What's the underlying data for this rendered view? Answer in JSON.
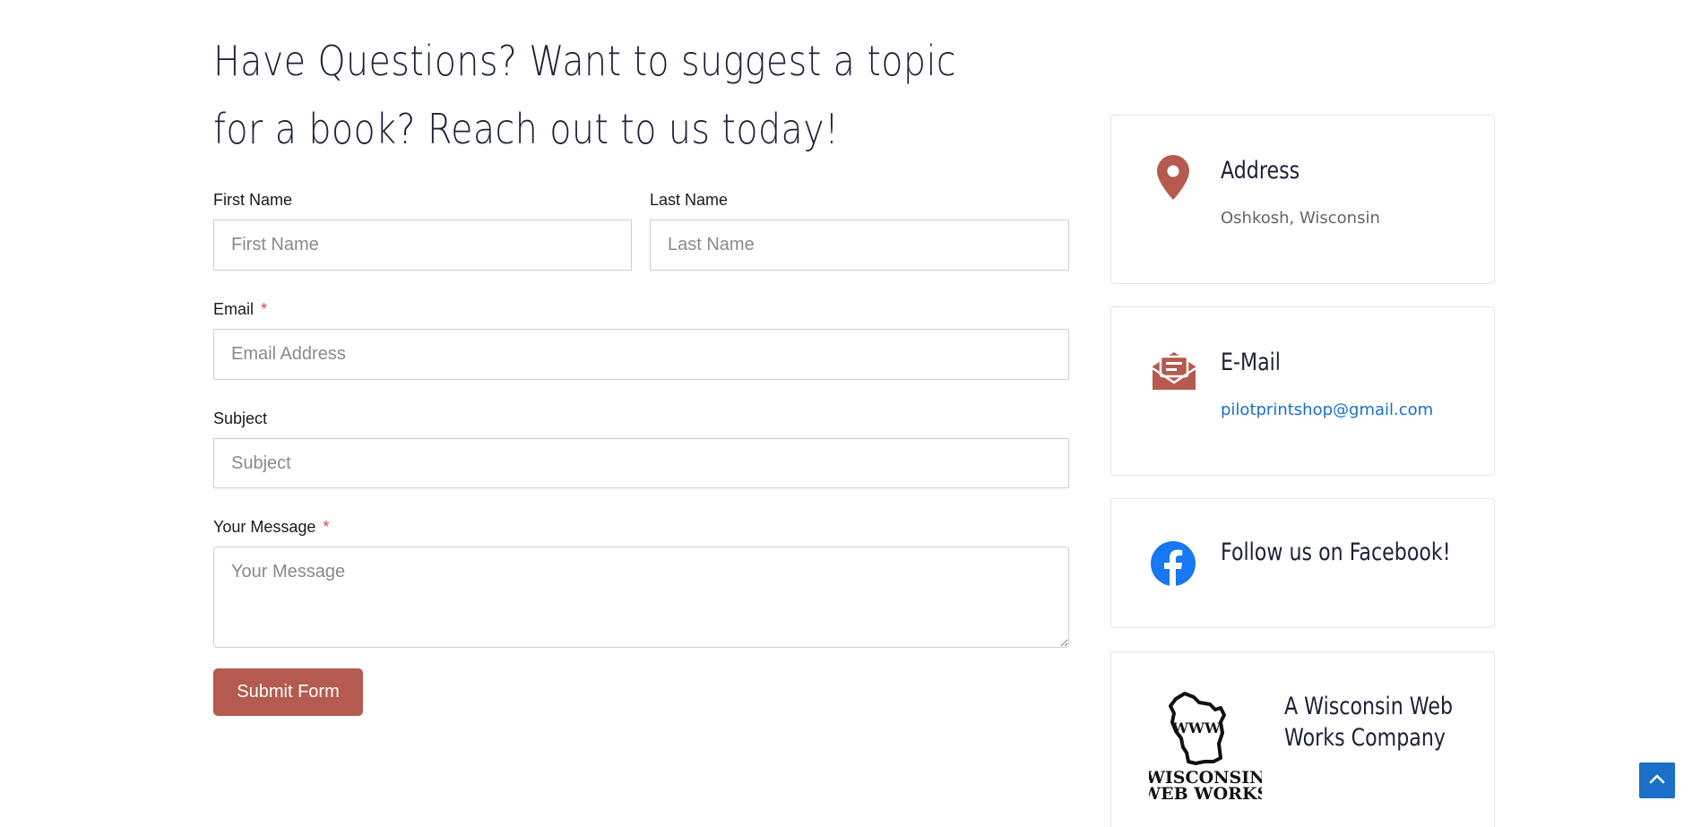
{
  "heading": "Have Questions? Want to suggest a topic for a book? Reach out to us today!",
  "form": {
    "first_name_label": "First Name",
    "first_name_placeholder": "First Name",
    "last_name_label": "Last Name",
    "last_name_placeholder": "Last Name",
    "email_label": "Email",
    "email_placeholder": "Email Address",
    "subject_label": "Subject",
    "subject_placeholder": "Subject",
    "message_label": "Your Message",
    "message_placeholder": "Your Message",
    "required_marker": "*",
    "submit_label": "Submit Form"
  },
  "cards": {
    "address": {
      "title": "Address",
      "text": "Oshkosh, Wisconsin",
      "icon": "map-pin-icon"
    },
    "email": {
      "title": "E-Mail",
      "text": "pilotprintshop@gmail.com",
      "icon": "envelope-open-icon"
    },
    "facebook": {
      "title": "Follow us on Facebook!",
      "icon": "facebook-icon"
    },
    "company": {
      "title": "A Wisconsin Web Works Company",
      "logo_text_center": "WWW",
      "logo_text_line1": "WISCONSIN",
      "logo_text_line2": "WEB WORKS"
    }
  },
  "colors": {
    "accent": "#b55a4e",
    "link": "#1a6fc9",
    "facebook": "#1877f2",
    "heading": "#1c2237"
  },
  "scroll_top": {
    "icon": "chevron-up-icon"
  }
}
